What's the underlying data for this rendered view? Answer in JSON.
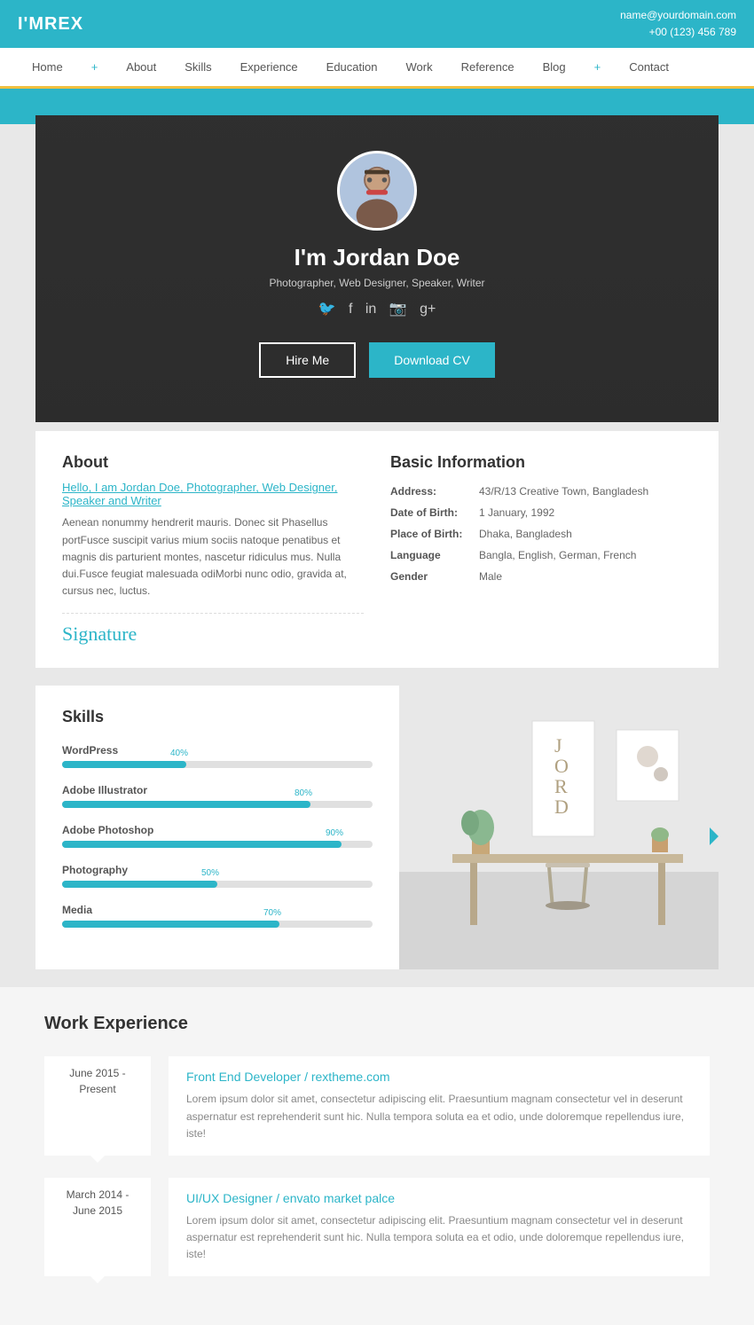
{
  "header": {
    "logo": "I'MREX",
    "email": "name@yourdomain.com",
    "phone": "+00 (123) 456 789"
  },
  "nav": {
    "items": [
      {
        "label": "Home",
        "id": "home"
      },
      {
        "label": "+",
        "id": "plus1"
      },
      {
        "label": "About",
        "id": "about"
      },
      {
        "label": "Skills",
        "id": "skills"
      },
      {
        "label": "Experience",
        "id": "experience"
      },
      {
        "label": "Education",
        "id": "education"
      },
      {
        "label": "Work",
        "id": "work"
      },
      {
        "label": "Reference",
        "id": "reference"
      },
      {
        "label": "Blog",
        "id": "blog"
      },
      {
        "label": "+",
        "id": "plus2"
      },
      {
        "label": "Contact",
        "id": "contact"
      }
    ]
  },
  "hero": {
    "name": "I'm Jordan Doe",
    "subtitle": "Photographer, Web Designer, Speaker, Writer",
    "hire_btn": "Hire Me",
    "download_btn": "Download CV"
  },
  "about": {
    "title": "About",
    "intro_link": "Hello, I am Jordan Doe, Photographer, Web Designer, Speaker and Writer",
    "body": "Aenean nonummy hendrerit mauris. Donec sit Phasellus portFusce suscipit varius mium sociis natoque penatibus et magnis dis parturient montes, nascetur ridiculus mus. Nulla dui.Fusce feugiat malesuada odiMorbi nunc odio, gravida at, cursus nec, luctus.",
    "signature": "Signature"
  },
  "basic_info": {
    "title": "Basic Information",
    "rows": [
      {
        "label": "Address:",
        "value": "43/R/13 Creative Town, Bangladesh"
      },
      {
        "label": "Date of Birth:",
        "value": "1 January, 1992"
      },
      {
        "label": "Place of Birth:",
        "value": "Dhaka, Bangladesh"
      },
      {
        "label": "Language",
        "value": "Bangla, English, German, French"
      },
      {
        "label": "Gender",
        "value": "Male"
      }
    ]
  },
  "skills": {
    "title": "Skills",
    "items": [
      {
        "name": "WordPress",
        "pct": 40,
        "label": "40%"
      },
      {
        "name": "Adobe Illustrator",
        "pct": 80,
        "label": "80%"
      },
      {
        "name": "Adobe Photoshop",
        "pct": 90,
        "label": "90%"
      },
      {
        "name": "Photography",
        "pct": 50,
        "label": "50%"
      },
      {
        "name": "Media",
        "pct": 70,
        "label": "70%"
      }
    ]
  },
  "work_experience": {
    "title": "Work Experience",
    "items": [
      {
        "date": "June 2015 - Present",
        "role": "Front End Developer",
        "company": " / rextheme.com",
        "description": "Lorem ipsum dolor sit amet, consectetur adipiscing elit. Praesuntium magnam consectetur vel in deserunt aspernatur est reprehenderit sunt hic. Nulla tempora soluta ea et odio, unde doloremque repellendus iure, iste!"
      },
      {
        "date": "March 2014 - June 2015",
        "role": "UI/UX Designer",
        "company": " / envato market palce",
        "description": "Lorem ipsum dolor sit amet, consectetur adipiscing elit. Praesuntium magnam consectetur vel in deserunt aspernatur est reprehenderit sunt hic. Nulla tempora soluta ea et odio, unde doloremque repellendus iure, iste!"
      }
    ]
  }
}
